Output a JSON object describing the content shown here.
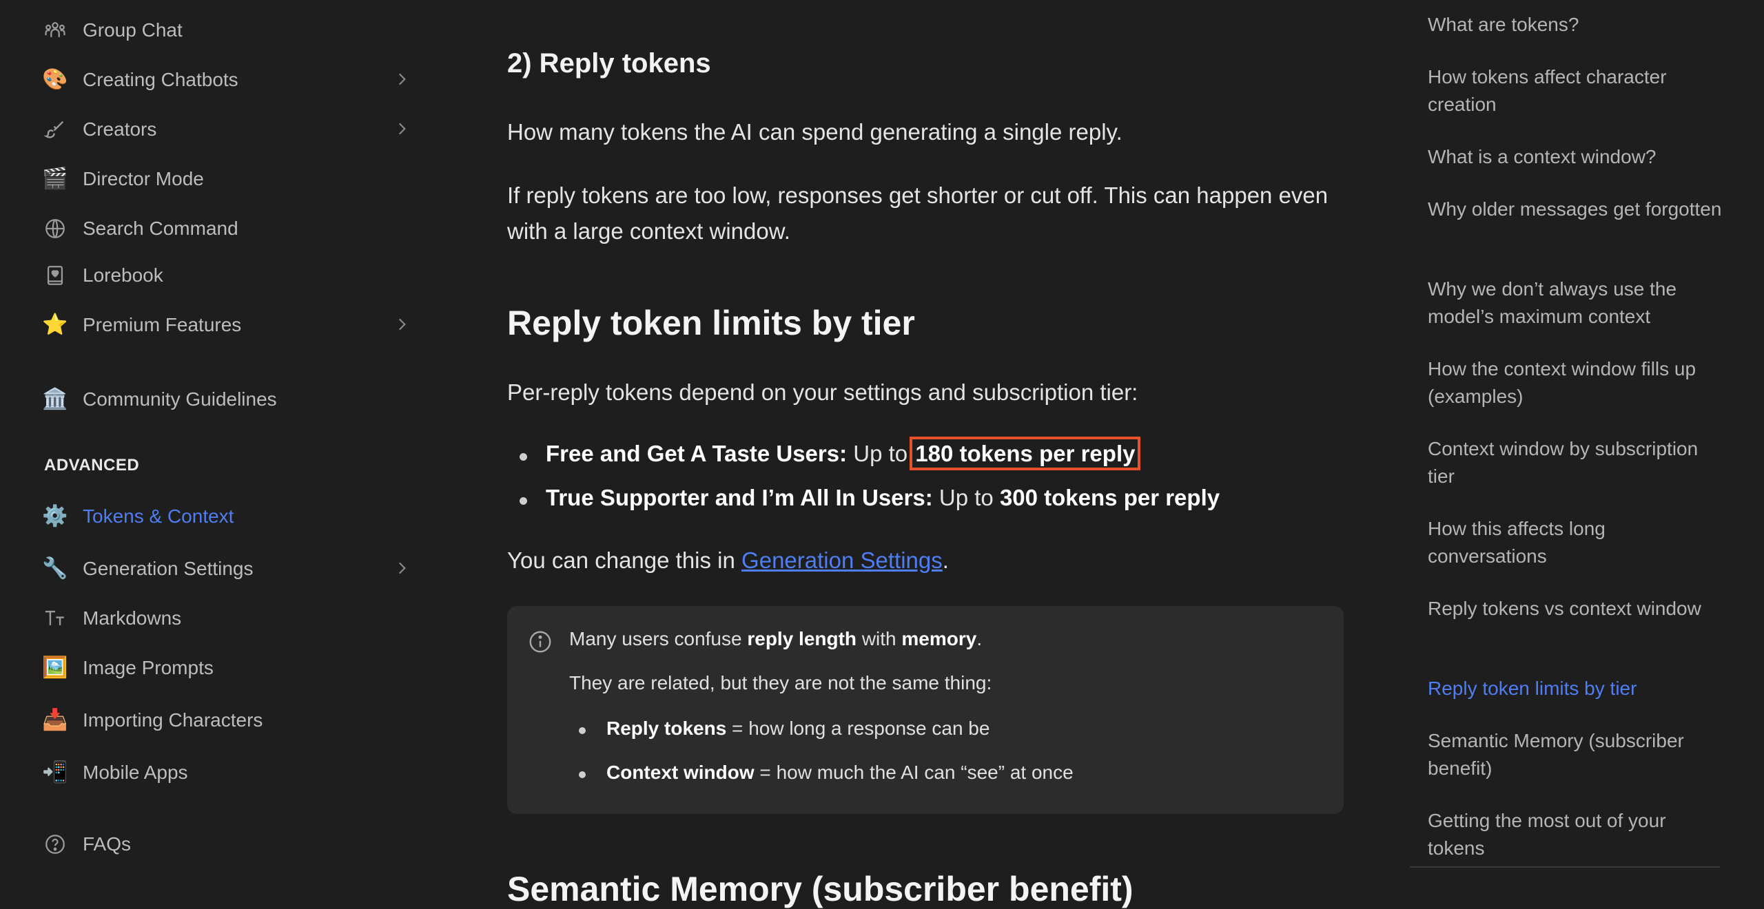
{
  "sidebar": {
    "items": [
      {
        "label": "Group Chat",
        "icon": "group-chat-icon"
      },
      {
        "label": "Creating Chatbots",
        "icon": "palette-icon"
      },
      {
        "label": "Creators",
        "icon": "brush-icon"
      },
      {
        "label": "Director Mode",
        "icon": "clapper-board-icon"
      },
      {
        "label": "Search Command",
        "icon": "globe-icon"
      },
      {
        "label": "Lorebook",
        "icon": "book-heart-icon"
      },
      {
        "label": "Premium Features",
        "icon": "star-icon"
      },
      {
        "label": "Community Guidelines",
        "icon": "classical-building-icon"
      },
      {
        "label": "Tokens & Context",
        "icon": "gear-icon"
      },
      {
        "label": "Generation Settings",
        "icon": "wrench-icon"
      },
      {
        "label": "Markdowns",
        "icon": "text-size-icon"
      },
      {
        "label": "Image Prompts",
        "icon": "framed-picture-icon"
      },
      {
        "label": "Importing Characters",
        "icon": "inbox-tray-icon"
      },
      {
        "label": "Mobile Apps",
        "icon": "mobile-arrow-icon"
      },
      {
        "label": "FAQs",
        "icon": "question-circle-icon"
      }
    ],
    "section_advanced": "ADVANCED",
    "active_color": "#4f7ef2"
  },
  "main": {
    "reply_heading": "2) Reply tokens",
    "p1": "How many tokens the AI can spend generating a single reply.",
    "p2": "If reply tokens are too low, responses get shorter or cut off. This can happen even with a large context window.",
    "limits_heading": "Reply token limits by tier",
    "p3": "Per-reply tokens depend on your settings and subscription tier:",
    "bullets": [
      {
        "bold": "Free and Get A Taste Users:",
        "text": " Up to ",
        "value": "180 tokens per reply"
      },
      {
        "bold": "True Supporter and I’m All In Users:",
        "text": " Up to ",
        "value": "300 tokens per reply"
      }
    ],
    "change_prefix": "You can change this in ",
    "change_link": "Generation Settings",
    "change_suffix": ".",
    "callout": {
      "line1_a": "Many users confuse ",
      "line1_b": "reply length",
      "line1_c": " with ",
      "line1_d": "memory",
      "line1_e": ".",
      "line2": "They are related, but they are not the same thing:",
      "bullets": [
        {
          "bold": "Reply tokens",
          "text": " = how long a response can be"
        },
        {
          "bold": "Context window",
          "text": " = how much the AI can “see” at once"
        }
      ]
    },
    "next_heading": "Semantic Memory (subscriber benefit)",
    "highlight_color": "#e8522a",
    "link_color": "#4f7ef2"
  },
  "toc": {
    "items": [
      "What are tokens?",
      "How tokens affect character creation",
      "What is a context window?",
      "Why older messages get forgotten",
      "Why we don’t always use the model’s maximum context",
      "How the context window fills up (examples)",
      "Context window by subscription tier",
      "How this affects long conversations",
      "Reply tokens vs context window",
      "Reply token limits by tier",
      "Semantic Memory (subscriber benefit)",
      "Getting the most out of your tokens"
    ],
    "active_index": 9
  }
}
